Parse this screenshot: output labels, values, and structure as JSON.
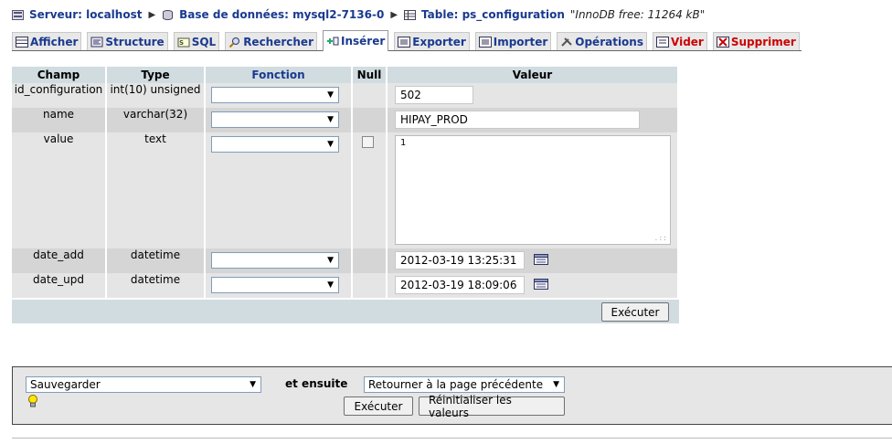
{
  "breadcrumb": {
    "server": "Serveur: localhost",
    "database": "Base de données: mysql2-7136-0",
    "table": "Table: ps_configuration",
    "info": "\"InnoDB free: 11264 kB\""
  },
  "tabs": [
    {
      "label": "Afficher",
      "icon": "browse-icon"
    },
    {
      "label": "Structure",
      "icon": "structure-icon"
    },
    {
      "label": "SQL",
      "icon": "sql-icon"
    },
    {
      "label": "Rechercher",
      "icon": "search-icon"
    },
    {
      "label": "Insérer",
      "icon": "insert-icon",
      "active": true
    },
    {
      "label": "Exporter",
      "icon": "export-icon"
    },
    {
      "label": "Importer",
      "icon": "import-icon"
    },
    {
      "label": "Opérations",
      "icon": "operations-icon"
    },
    {
      "label": "Vider",
      "icon": "empty-icon",
      "color": "#cc0000"
    },
    {
      "label": "Supprimer",
      "icon": "drop-icon",
      "color": "#cc0000"
    }
  ],
  "insert_table": {
    "headers": {
      "champ": "Champ",
      "type": "Type",
      "fonction": "Fonction",
      "null": "Null",
      "valeur": "Valeur"
    },
    "rows": [
      {
        "name": "id_configuration",
        "type": "int(10) unsigned",
        "function": "",
        "value": "502"
      },
      {
        "name": "name",
        "type": "varchar(32)",
        "function": "",
        "value": "HIPAY_PROD"
      },
      {
        "name": "value",
        "type": "text",
        "function": "",
        "null_checked": false,
        "value": "1"
      },
      {
        "name": "date_add",
        "type": "datetime",
        "function": "",
        "value": "2012-03-19 13:25:31"
      },
      {
        "name": "date_upd",
        "type": "datetime",
        "function": "",
        "value": "2012-03-19 18:09:06"
      }
    ],
    "execute_label": "Exécuter"
  },
  "bottom": {
    "action_select": "Sauvegarder",
    "and_then": "et ensuite",
    "after_select": "Retourner à la page précédente",
    "execute_label": "Exécuter",
    "reset_label": "Réinitialiser les valeurs"
  },
  "colors": {
    "link": "#1a3a8f",
    "danger": "#cc0000",
    "header_bg": "#d0dce0",
    "row_odd": "#e5e5e5",
    "row_even": "#d5d5d5"
  }
}
